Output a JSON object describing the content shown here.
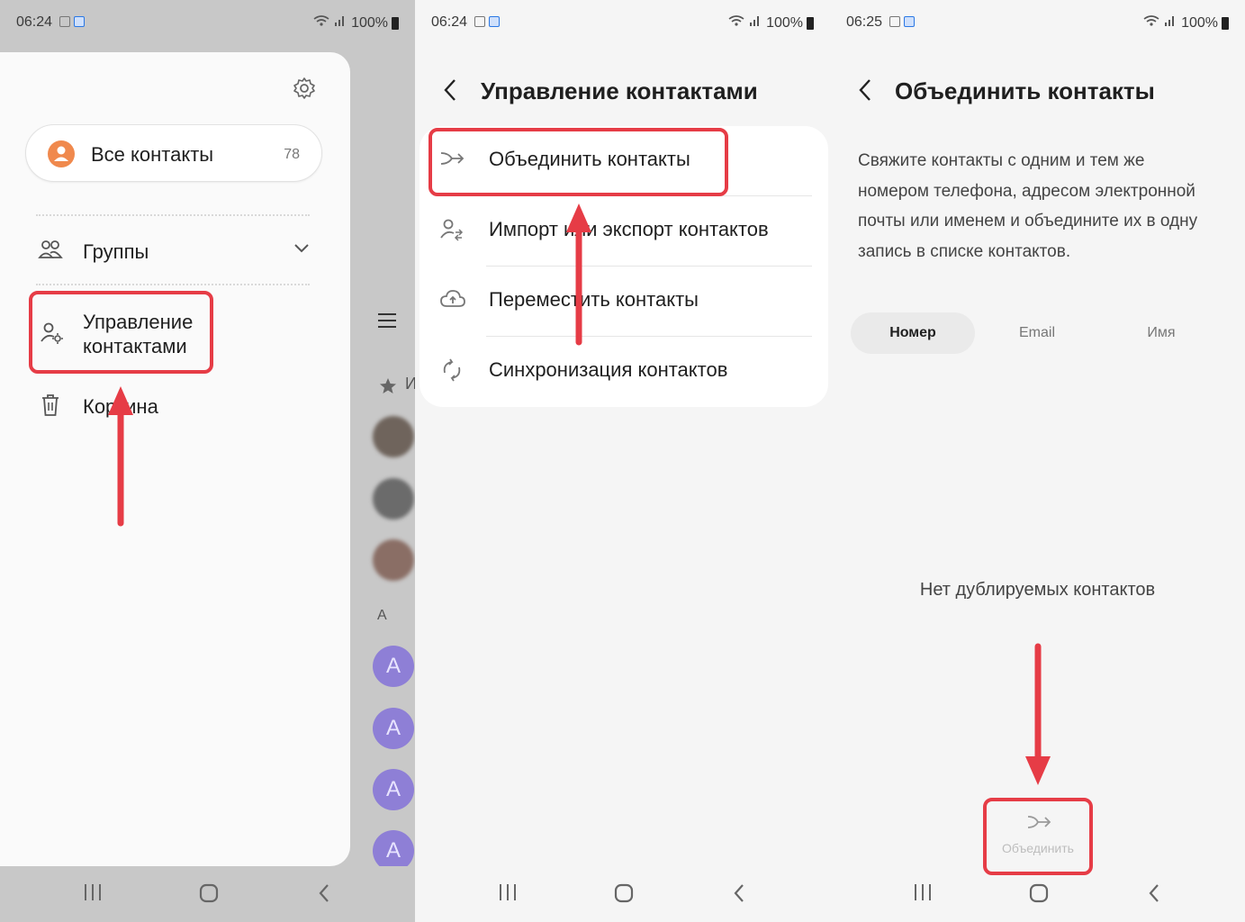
{
  "screens": [
    {
      "status": {
        "time": "06:24",
        "battery": "100%"
      },
      "all_contacts": {
        "label": "Все контакты",
        "count": "78"
      },
      "menu": [
        {
          "label": "Группы",
          "icon": "group-icon"
        },
        {
          "label": "Управление\nконтактами",
          "icon": "manage-contacts-icon"
        },
        {
          "label": "Корзина",
          "icon": "trash-icon"
        }
      ],
      "list_peek": {
        "fav_letter": "И",
        "section_letter": "А",
        "avatar_letter": "A"
      }
    },
    {
      "status": {
        "time": "06:24",
        "battery": "100%"
      },
      "title": "Управление контактами",
      "items": [
        {
          "label": "Объединить контакты",
          "icon": "merge-icon"
        },
        {
          "label": "Импорт или экспорт контактов",
          "icon": "import-export-icon"
        },
        {
          "label": "Переместить контакты",
          "icon": "cloud-upload-icon"
        },
        {
          "label": "Синхронизация контактов",
          "icon": "sync-icon"
        }
      ]
    },
    {
      "status": {
        "time": "06:25",
        "battery": "100%"
      },
      "title": "Объединить контакты",
      "description": "Свяжите контакты с одним и тем же номером телефона, адресом электронной почты или именем и объедините их в одну запись в списке контактов.",
      "tabs": [
        {
          "label": "Номер",
          "selected": true
        },
        {
          "label": "Email",
          "selected": false
        },
        {
          "label": "Имя",
          "selected": false
        }
      ],
      "empty_text": "Нет дублируемых контактов",
      "merge_button": "Объединить"
    }
  ],
  "colors": {
    "highlight": "#e63c46",
    "accent_avatar": "#f0894d",
    "list_avatar": "#8e7fd6"
  }
}
